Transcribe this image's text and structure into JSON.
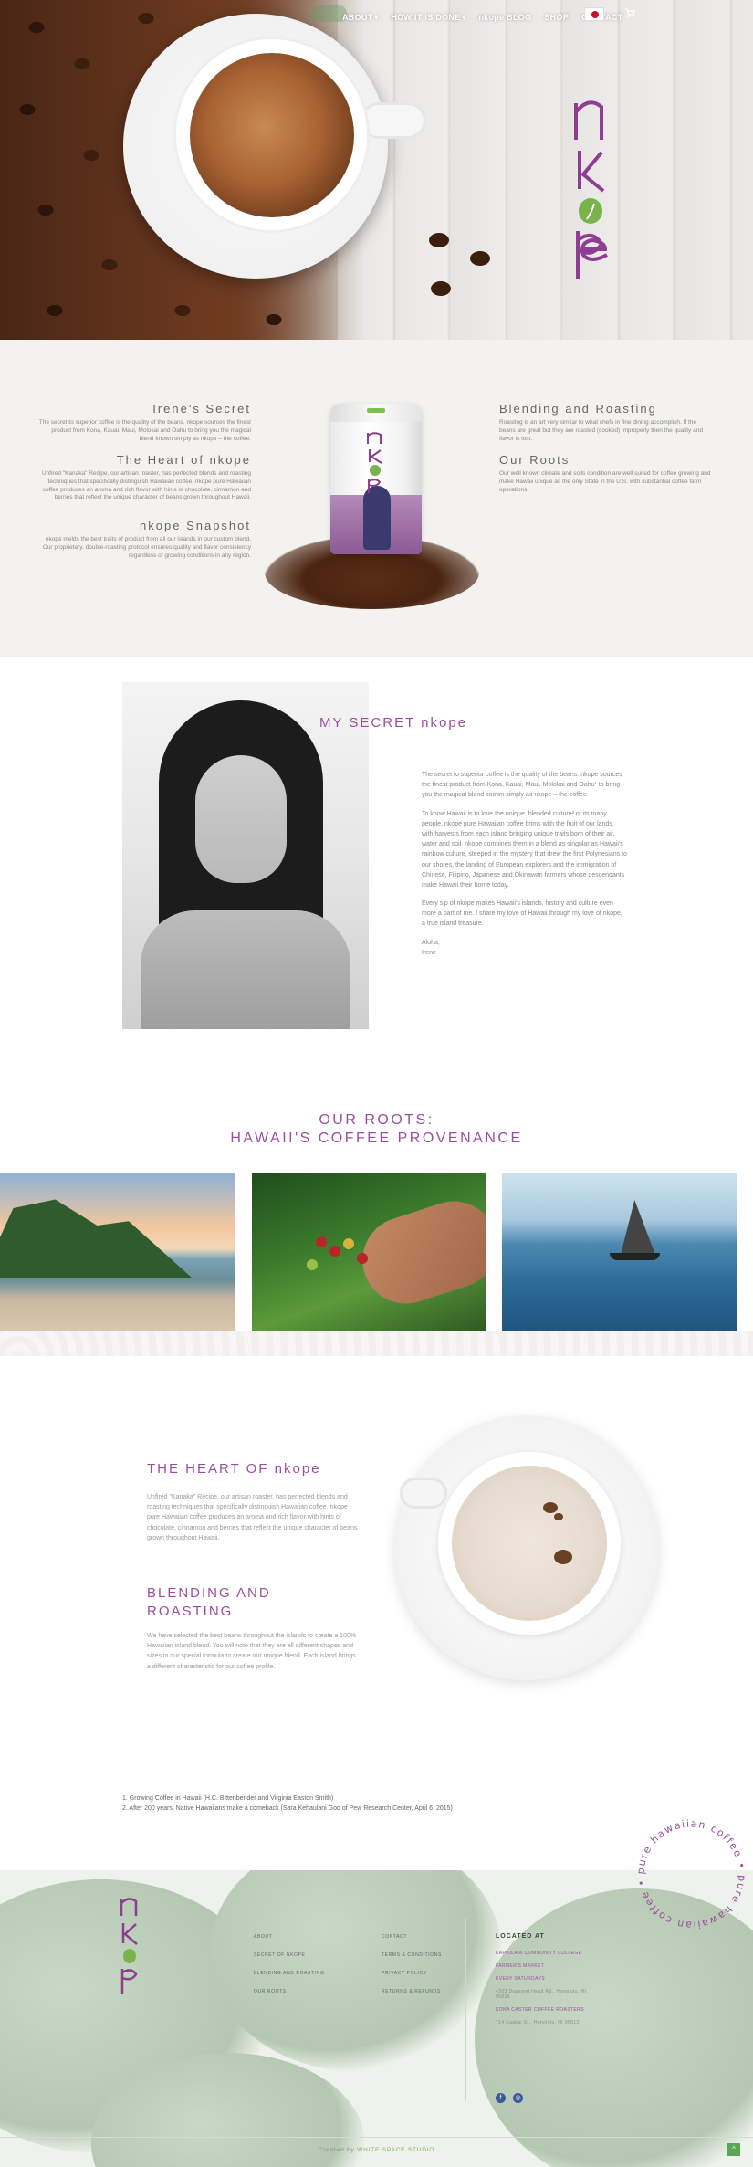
{
  "nav": {
    "items": [
      {
        "label": "ABOUT",
        "dropdown": true
      },
      {
        "label": "HOW IT IS DONE",
        "dropdown": true
      },
      {
        "label": "nkope BLOG",
        "dropdown": false
      },
      {
        "label": "SHOP",
        "dropdown": false
      },
      {
        "label": "CONTACT",
        "dropdown": false
      }
    ],
    "language_flag": "japan-flag-icon",
    "cart_icon": "cart-icon"
  },
  "brand": {
    "logo_text": "nkope",
    "accent": "#9b4ea0",
    "green": "#7ab24b"
  },
  "intro": {
    "left": [
      {
        "title": "Irene's Secret",
        "text": "The secret to superior coffee is the quality of the beans. nkope sources the finest product from Kona, Kauai, Maui, Molokai and Oahu to bring you the magical blend known simply as nkope – the coffee."
      },
      {
        "title": "The Heart of nkope",
        "text": "Unfired \"Kanaka\" Recipe, our artisan roaster, has perfected blends and roasting techniques that specifically distinguish Hawaiian coffee. nkope pure Hawaiian coffee produces an aroma and rich flavor with hints of chocolate, cinnamon and berries that reflect the unique character of beans grown throughout Hawaii."
      },
      {
        "title": "nkope Snapshot",
        "text": "nkope melds the best traits of product from all our islands in our custom blend. Our proprietary, double-roasting protocol ensures quality and flavor consistency regardless of growing conditions in any region."
      }
    ],
    "right": [
      {
        "title": "Blending and Roasting",
        "text": "Roasting is an art very similar to what chefs in fine dining accomplish. If the beans are great but they are roasted (cooked) improperly then the quality and flavor is lost."
      },
      {
        "title": "Our Roots",
        "text": "Our well known climate and soils condition are well suited for coffee growing and make Hawaii unique as the only State in the U.S. with substantial coffee farm operations."
      }
    ]
  },
  "secret": {
    "title": "MY SECRET nkope",
    "paragraphs": [
      "The secret to superior coffee is the quality of the beans. nkope sources the finest product from Kona, Kauai, Maui, Molokai and Oahu¹ to bring you the magical blend known simply as nkope – the coffee.",
      "To know Hawaii is to love the unique, blended culture² of its many people. nkope pure Hawaiian coffee brims with the fruit of our lands, with harvests from each island bringing unique traits born of their air, water and soil. nkope combines them in a blend as singular as Hawaii's rainbow culture, steeped in the mystery that drew the first Polynesians to our shores, the landing of European explorers and the immigration of Chinese, Filipino, Japanese and Okinawan farmers whose descendants make Hawaii their home today.",
      "Every sip of nkope makes Hawaii's islands, history and culture even more a part of me. I share my love of Hawaii through my love of nkope, a true island treasure.",
      "Aloha,\nIrene"
    ]
  },
  "roots": {
    "title_line1": "OUR ROOTS:",
    "title_line2": "HAWAII'S COFFEE PROVENANCE"
  },
  "heart": {
    "title": "THE HEART OF nkope",
    "text": "Unfired \"Kanaka\" Recipe, our artisan roaster, has perfected blends and roasting techniques that specifically distinguish Hawaiian coffee. nkope pure Hawaiian coffee produces an aroma and rich flavor with hints of chocolate, cinnamon and berries that reflect the unique character of beans grown throughout Hawaii.",
    "blend_title": "BLENDING AND ROASTING",
    "blend_text": "We have selected the best beans throughout the islands to create a 100% Hawaiian island blend. You will note that they are all different shapes and sizes in our special formula to create our unique blend. Each island brings a different characteristic for our coffee profile."
  },
  "footnotes": [
    "1. Growing Coffee in Hawaii (H.C. Bittenbender and Virginia Easton Smith)",
    "2. After 200 years, Native Hawaiians make a comeback (Sara Kehaulani Goo of Pew Research Center, April 6, 2015)"
  ],
  "footer": {
    "ring_text": "pure hawaiian coffee • pure hawaiian coffee •",
    "col1": [
      "ABOUT",
      "SECRET OF nkope",
      "BLENDING AND ROASTING",
      "OUR ROOTS"
    ],
    "col2": [
      "CONTACT",
      "TERMS & CONDITIONS",
      "PRIVACY POLICY",
      "RETURNS & REFUNDS"
    ],
    "located_title": "LOCATED AT",
    "locations": [
      {
        "label": "KAPIOLANI COMMUNITY COLLEGE",
        "link": true
      },
      {
        "label": "FARMER'S MARKET",
        "link": true
      },
      {
        "label": "EVERY SATURDAYS",
        "link": true
      },
      {
        "label": "4303 Diamond Head Rd., Honolulu, HI 96816",
        "link": false
      },
      {
        "label": "KONA CASTER COFFEE ROASTERS",
        "link": true
      },
      {
        "label": "714 Kaakai St., Honolulu, HI 96813",
        "link": false
      }
    ],
    "social": [
      "facebook-icon",
      "instagram-icon"
    ],
    "credit_prefix": "Created by",
    "credit_name": "WHITE SPACE STUDIO",
    "to_top": "^"
  }
}
